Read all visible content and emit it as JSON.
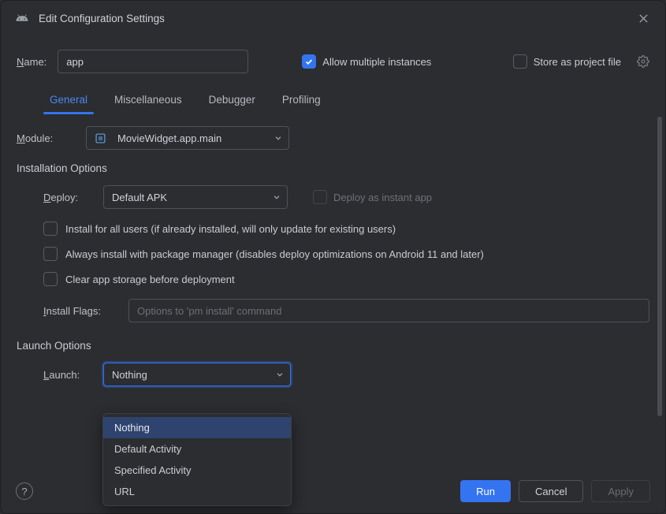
{
  "title": "Edit Configuration Settings",
  "name": {
    "label": "Name:",
    "value": "app"
  },
  "allow_multi": {
    "label": "Allow multiple instances",
    "checked": true
  },
  "store_project": {
    "label": "Store as project file",
    "checked": false
  },
  "tabs": {
    "general": "General",
    "misc": "Miscellaneous",
    "debugger": "Debugger",
    "profiling": "Profiling"
  },
  "module": {
    "label": "Module:",
    "value": "MovieWidget.app.main"
  },
  "install_section": "Installation Options",
  "deploy": {
    "label": "Deploy:",
    "value": "Default APK"
  },
  "deploy_instant": {
    "label": "Deploy as instant app",
    "checked": false
  },
  "opts": {
    "all_users": "Install for all users (if already installed, will only update for existing users)",
    "pkg_mgr": "Always install with package manager (disables deploy optimizations on Android 11 and later)",
    "clear_storage": "Clear app storage before deployment"
  },
  "install_flags": {
    "label": "Install Flags:",
    "placeholder": "Options to 'pm install' command",
    "value": ""
  },
  "launch_section": "Launch Options",
  "launch": {
    "label": "Launch:",
    "value": "Nothing"
  },
  "launch_options": {
    "nothing": "Nothing",
    "default_activity": "Default Activity",
    "specified_activity": "Specified Activity",
    "url": "URL"
  },
  "buttons": {
    "run": "Run",
    "cancel": "Cancel",
    "apply": "Apply"
  },
  "help": "?"
}
